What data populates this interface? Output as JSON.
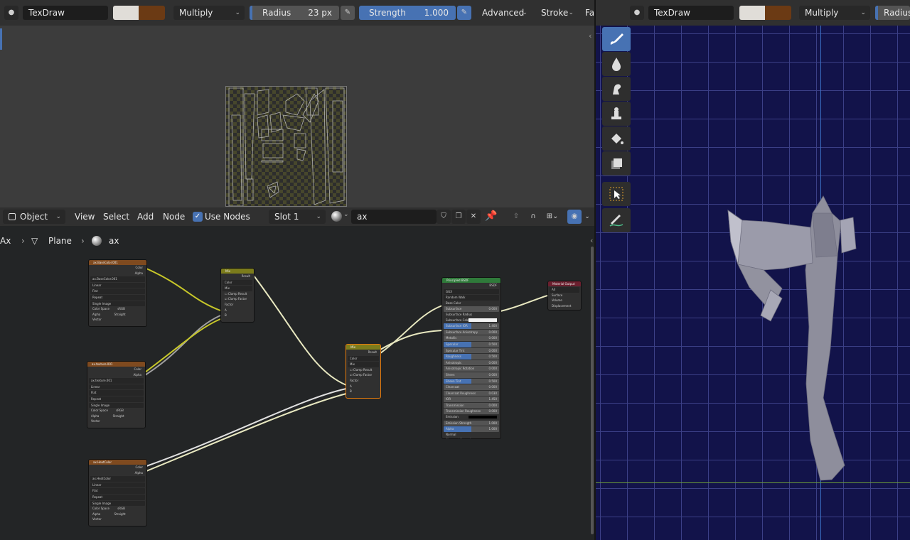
{
  "image_editor": {
    "header": {
      "brush_name": "TexDraw",
      "blend_mode": "Multiply",
      "radius_label": "Radius",
      "radius_value": "23 px",
      "strength_label": "Strength",
      "strength_value": "1.000",
      "advanced_label": "Advanced",
      "stroke_label": "Stroke",
      "falloff_label": "Fa",
      "colors": {
        "primary": "#e0ddd8",
        "secondary": "#6b3a14"
      }
    }
  },
  "node_editor": {
    "header": {
      "mode": "Object",
      "menus": [
        "View",
        "Select",
        "Add",
        "Node"
      ],
      "use_nodes_label": "Use Nodes",
      "slot": "Slot 1",
      "material_name": "ax"
    },
    "breadcrumb": {
      "object": "Ax",
      "mesh": "Plane",
      "material": "ax"
    },
    "nodes": {
      "tex1": {
        "title": "ax.BaseColor.001",
        "image": "ax.BaseColor.001",
        "outputs": [
          "Color",
          "Alpha"
        ],
        "rows": [
          "Linear",
          "Flat",
          "Repeat",
          "Single Image"
        ],
        "colorspace_label": "Color Space",
        "colorspace": "sRGB",
        "alpha_label": "Alpha",
        "alpha": "Straight",
        "vector": "Vector"
      },
      "tex2": {
        "title": "ax.texture.001",
        "image": "ax.texture.001",
        "outputs": [
          "Color",
          "Alpha"
        ],
        "rows": [
          "Linear",
          "Flat",
          "Repeat",
          "Single Image"
        ],
        "colorspace_label": "Color Space",
        "colorspace": "sRGB",
        "alpha_label": "Alpha",
        "alpha": "Straight",
        "vector": "Vector"
      },
      "tex3": {
        "title": "ax.HeatColor",
        "image": "ax.HeatColor",
        "outputs": [
          "Color",
          "Alpha"
        ],
        "rows": [
          "Linear",
          "Flat",
          "Repeat",
          "Single Image"
        ],
        "colorspace_label": "Color Space",
        "colorspace": "sRGB",
        "alpha_label": "Alpha",
        "alpha": "Straight",
        "vector": "Vector"
      },
      "mix1": {
        "title": "Mix",
        "output": "Result",
        "type": "Color",
        "blend": "Mix",
        "clamp_result": "Clamp Result",
        "clamp_factor": "Clamp Factor",
        "inputs": [
          "Factor",
          "A",
          "B"
        ]
      },
      "mix2": {
        "title": "Mix",
        "output": "Result",
        "type": "Color",
        "blend": "Mix",
        "clamp_result": "Clamp Result",
        "clamp_factor": "Clamp Factor",
        "inputs": [
          "Factor",
          "A",
          "B"
        ]
      },
      "bsdf": {
        "title": "Principled BSDF",
        "output": "BSDF",
        "distribution": "GGX",
        "subsurface_method": "Random Walk",
        "rows": [
          {
            "label": "Base Color",
            "value": ""
          },
          {
            "label": "Subsurface",
            "value": "0.000"
          },
          {
            "label": "Subsurface Radius",
            "value": ""
          },
          {
            "label": "Subsurface Color",
            "value": ""
          },
          {
            "label": "Subsurface IOR",
            "value": "1.400"
          },
          {
            "label": "Subsurface Anisotropy",
            "value": "0.000"
          },
          {
            "label": "Metallic",
            "value": "0.000"
          },
          {
            "label": "Specular",
            "value": "0.500"
          },
          {
            "label": "Specular Tint",
            "value": "0.000"
          },
          {
            "label": "Roughness",
            "value": "0.500"
          },
          {
            "label": "Anisotropic",
            "value": "0.000"
          },
          {
            "label": "Anisotropic Rotation",
            "value": "0.000"
          },
          {
            "label": "Sheen",
            "value": "0.000"
          },
          {
            "label": "Sheen Tint",
            "value": "0.500"
          },
          {
            "label": "Clearcoat",
            "value": "0.000"
          },
          {
            "label": "Clearcoat Roughness",
            "value": "0.030"
          },
          {
            "label": "IOR",
            "value": "1.450"
          },
          {
            "label": "Transmission",
            "value": "0.000"
          },
          {
            "label": "Transmission Roughness",
            "value": "0.000"
          },
          {
            "label": "Emission",
            "value": ""
          },
          {
            "label": "Emission Strength",
            "value": "1.000"
          },
          {
            "label": "Alpha",
            "value": "1.000"
          },
          {
            "label": "Normal",
            "value": ""
          },
          {
            "label": "Clearcoat Normal",
            "value": ""
          },
          {
            "label": "Tangent",
            "value": ""
          }
        ]
      },
      "output": {
        "title": "Material Output",
        "target": "All",
        "inputs": [
          "Surface",
          "Volume",
          "Displacement"
        ]
      }
    }
  },
  "viewport": {
    "header": {
      "brush_name": "TexDraw",
      "blend_mode": "Multiply",
      "radius_label": "Radius"
    },
    "tools": [
      "draw-brush-icon",
      "soften-icon",
      "smear-icon",
      "clone-icon",
      "fill-icon",
      "mask-icon",
      "select-box-icon",
      "annotate-icon"
    ]
  }
}
